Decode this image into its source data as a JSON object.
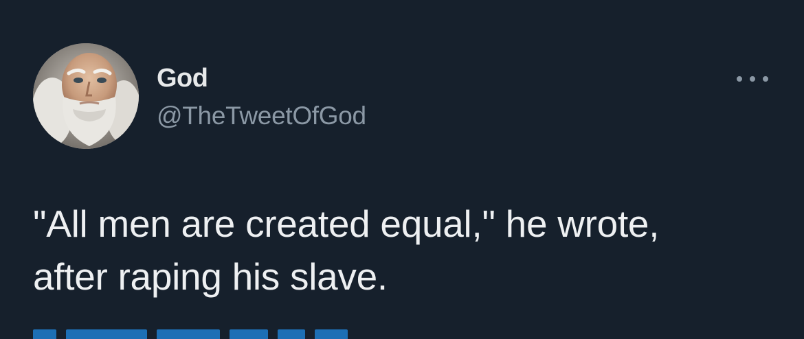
{
  "tweet": {
    "author_name": "God",
    "author_handle": "@TheTweetOfGod",
    "more_icon": "more-horizontal-icon",
    "text": "\"All men are created equal,\" he wrote,\nafter raping his slave."
  },
  "colors": {
    "background": "#16202c",
    "primary_text": "#e7e9ea",
    "secondary_text": "#8b98a5",
    "link": "#1d9bf0"
  }
}
